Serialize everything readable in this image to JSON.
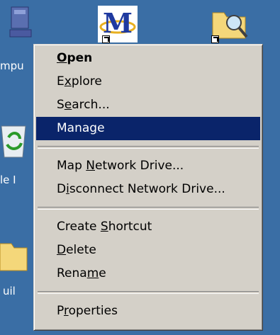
{
  "desktop": {
    "labels": {
      "computer": "mpu",
      "recycle": "le I",
      "build": "uil"
    }
  },
  "menu": {
    "items": [
      {
        "pre": "",
        "key": "O",
        "post": "pen",
        "bold": true,
        "highlight": false
      },
      {
        "pre": "E",
        "key": "x",
        "post": "plore",
        "bold": false,
        "highlight": false
      },
      {
        "pre": "S",
        "key": "e",
        "post": "arch...",
        "bold": false,
        "highlight": false
      },
      {
        "pre": "Mana",
        "key": "g",
        "post": "e",
        "bold": false,
        "highlight": true
      },
      {
        "pre": "Map ",
        "key": "N",
        "post": "etwork Drive...",
        "bold": false,
        "highlight": false
      },
      {
        "pre": "D",
        "key": "i",
        "post": "sconnect Network Drive...",
        "bold": false,
        "highlight": false
      },
      {
        "pre": "Create ",
        "key": "S",
        "post": "hortcut",
        "bold": false,
        "highlight": false
      },
      {
        "pre": "",
        "key": "D",
        "post": "elete",
        "bold": false,
        "highlight": false
      },
      {
        "pre": "Rena",
        "key": "m",
        "post": "e",
        "bold": false,
        "highlight": false
      },
      {
        "pre": "P",
        "key": "r",
        "post": "operties",
        "bold": false,
        "highlight": false
      }
    ]
  },
  "colors": {
    "desktop_bg": "#3a6ea5",
    "menu_bg": "#d4d0c8",
    "highlight_bg": "#0a246a"
  }
}
